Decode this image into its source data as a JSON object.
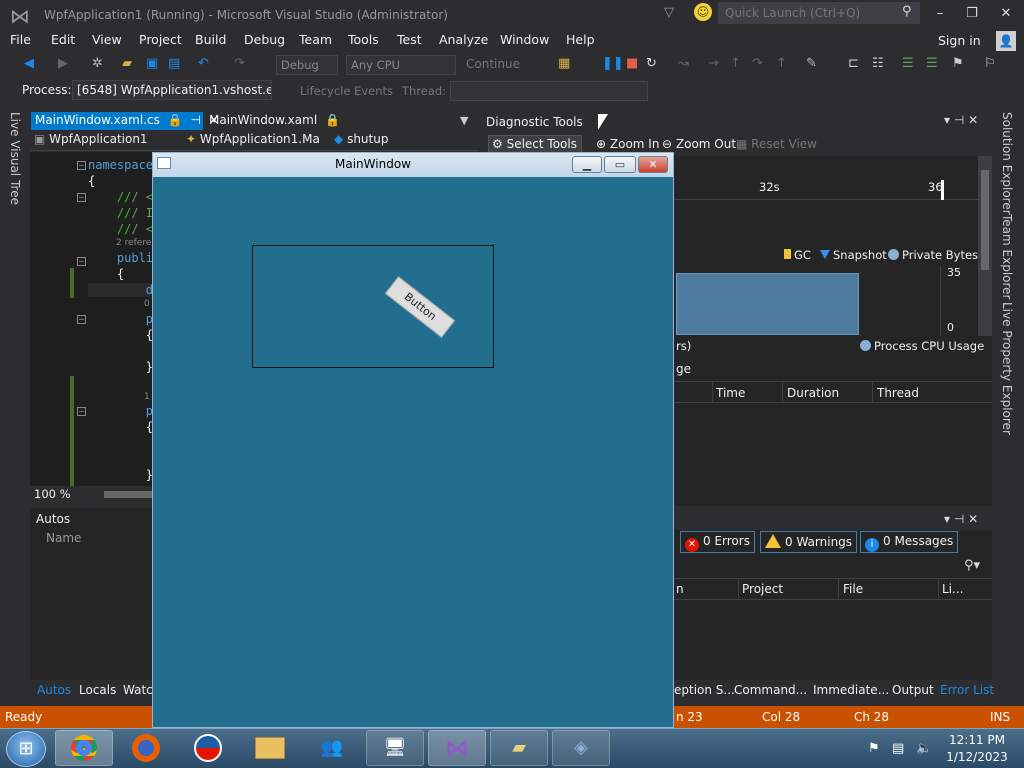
{
  "titlebar": {
    "title": "WpfApplication1 (Running) - Microsoft Visual Studio (Administrator)",
    "quick_launch_placeholder": "Quick Launch (Ctrl+Q)",
    "min": "–",
    "max": "❐",
    "close": "✕"
  },
  "menu": [
    "File",
    "Edit",
    "View",
    "Project",
    "Build",
    "Debug",
    "Team",
    "Tools",
    "Test",
    "Analyze",
    "Window",
    "Help"
  ],
  "signin": "Sign in",
  "toolbar": {
    "config": "Debug",
    "platform": "Any CPU",
    "continue": "Continue"
  },
  "process": {
    "label": "Process:",
    "value": "[6548] WpfApplication1.vshost.exe",
    "lifecycle": "Lifecycle Events",
    "thread_label": "Thread:"
  },
  "side_tabs": {
    "left": "Live Visual Tree",
    "right1": "Solution Explorer",
    "right2": "Team Explorer",
    "right3": "Live Property Explorer"
  },
  "doc_tabs": {
    "tab1": "MainWindow.xaml.cs",
    "tab2": "MainWindow.xaml",
    "nav1": "WpfApplication1",
    "nav2": "WpfApplication1.Ma",
    "nav3": "shutup"
  },
  "code": {
    "l1": "namespace",
    "l2": "{",
    "l3": "    /// <",
    "l4": "    /// I",
    "l5": "    /// <",
    "l6": "2 refere",
    "l7": "    publi",
    "l8": "    {",
    "l9": "        d",
    "l10": "0",
    "l11": "        p",
    "l12": "        {",
    "l13": "        }",
    "l14": "1",
    "l15": "        p",
    "l16": "        {",
    "l17": "        }"
  },
  "zoom": "100 %",
  "autos": {
    "title": "Autos",
    "col_name": "Name"
  },
  "bottom_left_tabs": [
    "Autos",
    "Locals",
    "Watc"
  ],
  "diagnostic": {
    "title": "Diagnostic Tools",
    "select_tools": "Select Tools",
    "zoom_in": "Zoom In",
    "zoom_out": "Zoom Out",
    "reset_view": "Reset View",
    "timeline_32": "32s",
    "timeline_36": "36",
    "legend_gc": "GC",
    "legend_snapshot": "Snapshot",
    "legend_private": "Private Bytes",
    "axis_max": "35",
    "axis_min": "0",
    "cpu_row": "rs)",
    "cpu_legend": "Process CPU Usage",
    "events_label": "ge",
    "cols": [
      "Time",
      "Duration",
      "Thread"
    ]
  },
  "errors": {
    "errors": "0 Errors",
    "warnings": "0 Warnings",
    "messages": "0 Messages",
    "cols": [
      "n",
      "Project",
      "File",
      "Li..."
    ],
    "tabs": [
      "eption S...",
      "Command...",
      "Immediate...",
      "Output",
      "Error List"
    ]
  },
  "status": {
    "ready": "Ready",
    "ln": "n 23",
    "col": "Col 28",
    "ch": "Ch 28",
    "ins": "INS"
  },
  "wpf": {
    "title": "MainWindow",
    "button": "Button"
  },
  "taskbar": {
    "time": "12:11 PM",
    "date": "1/12/2023"
  },
  "colors": {
    "accent": "#007acc",
    "statusbar": "#ca5100",
    "wpf_bg": "#226e8e"
  }
}
